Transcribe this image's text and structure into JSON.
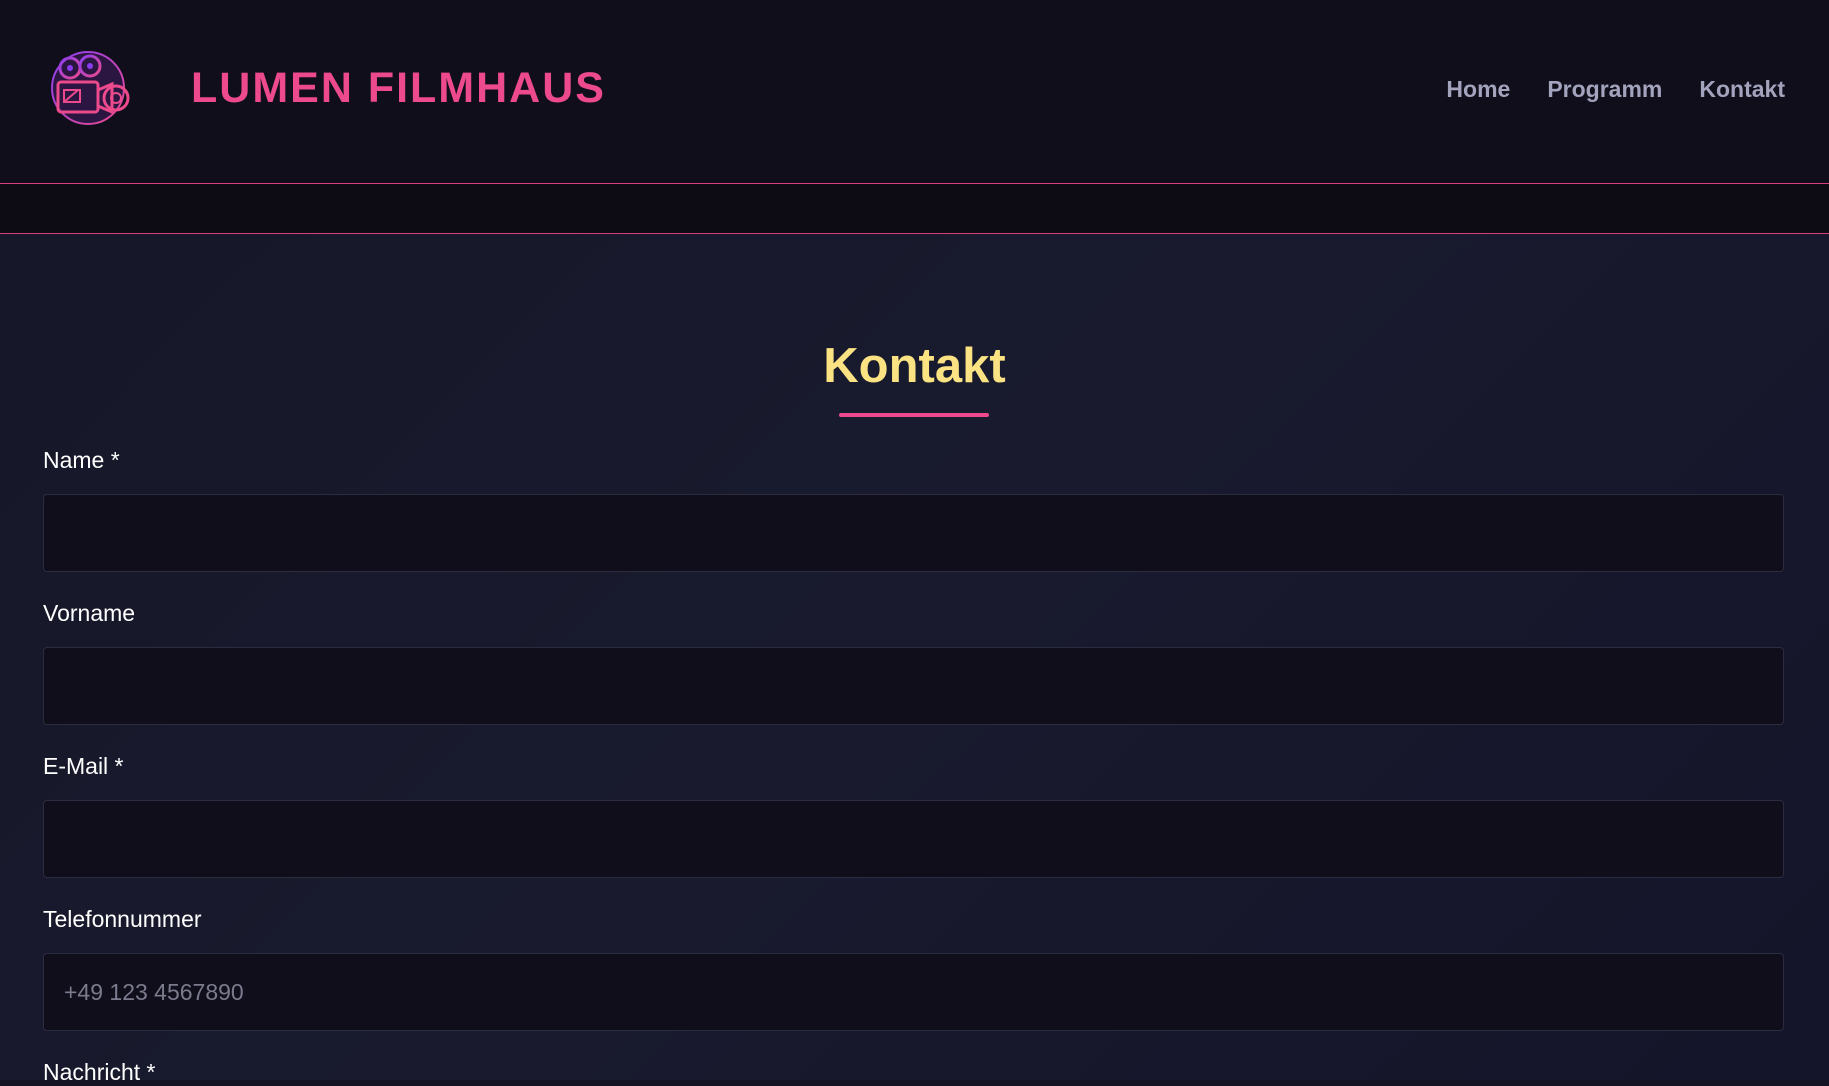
{
  "header": {
    "logo_icon": "film-camera-logo-icon",
    "brand": "LUMEN FILMHAUS",
    "nav": [
      {
        "label": "Home"
      },
      {
        "label": "Programm"
      },
      {
        "label": "Kontakt"
      }
    ]
  },
  "colors": {
    "accent": "#ec4a8d",
    "title": "#fbe283",
    "nav_text": "#a3a3bd",
    "header_bg": "#0f0e1a",
    "page_bg": "#161829"
  },
  "main": {
    "title": "Kontakt",
    "fields": [
      {
        "label": "Name *",
        "value": "",
        "placeholder": ""
      },
      {
        "label": "Vorname",
        "value": "",
        "placeholder": ""
      },
      {
        "label": "E-Mail *",
        "value": "",
        "placeholder": ""
      },
      {
        "label": "Telefonnummer",
        "value": "",
        "placeholder": "+49 123 4567890"
      },
      {
        "label": "Nachricht *"
      }
    ]
  }
}
